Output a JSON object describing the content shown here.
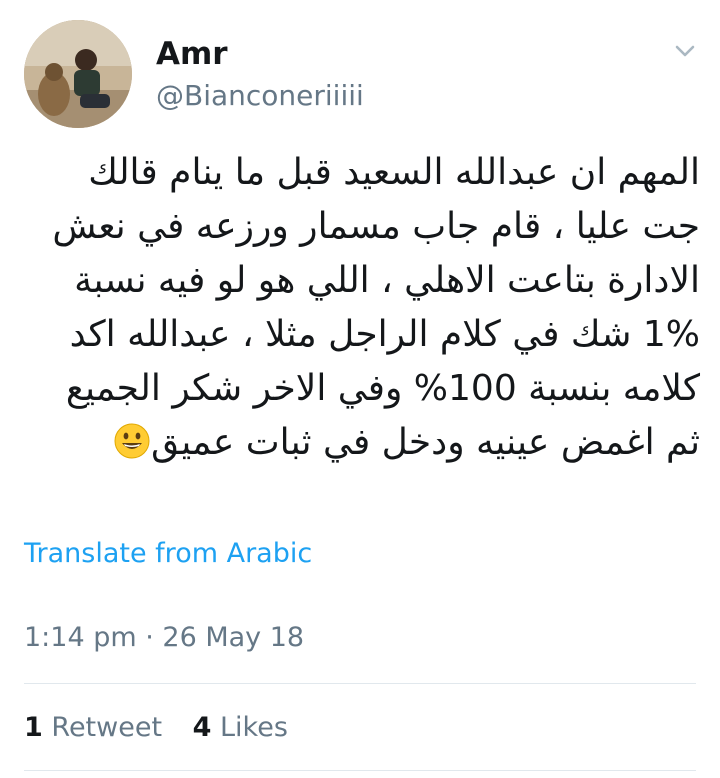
{
  "user": {
    "name": "Amr",
    "handle": "@Bianconeriiiii"
  },
  "tweet": {
    "lines": [
      "المهم ان عبدالله السعيد قبل ما ينام قالك",
      "جت عليا ، قام جاب مسمار ورزعه في نعش",
      "الادارة بتاعت الاهلي ، اللي هو لو فيه نسبة",
      "1% شك في كلام الراجل مثلا ، عبدالله اكد",
      "كلامه بنسبة 100% وفي الاخر شكر الجميع",
      "ثم اغمض عينيه ودخل في ثبات عميق"
    ],
    "emoji": "grinning-face-emoji"
  },
  "translate_label": "Translate from Arabic",
  "timestamp": "1:14 pm · 26 May 18",
  "stats": {
    "retweets_count": "1",
    "retweets_label": "Retweet",
    "likes_count": "4",
    "likes_label": "Likes"
  },
  "colors": {
    "link": "#1da1f2",
    "secondary_text": "#657786",
    "primary_text": "#14171a",
    "divider": "#e1e8ed"
  },
  "icons": {
    "menu": "chevron-down-icon"
  }
}
